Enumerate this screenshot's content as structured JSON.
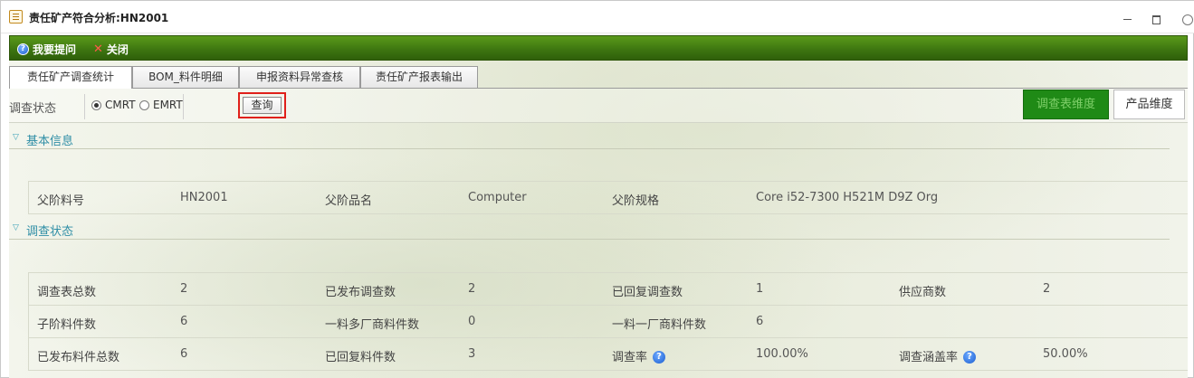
{
  "window": {
    "title": "责任矿产符合分析:HN2001"
  },
  "toolbar": {
    "ask_label": "我要提问",
    "close_label": "关闭"
  },
  "tabs": [
    {
      "label": "责任矿产调查统计"
    },
    {
      "label": "BOM_料件明细"
    },
    {
      "label": "申报资料异常查核"
    },
    {
      "label": "责任矿产报表输出"
    }
  ],
  "query": {
    "status_label": "调查状态",
    "options": [
      {
        "label": "CMRT",
        "checked": true
      },
      {
        "label": "EMRT",
        "checked": false
      }
    ],
    "query_button": "查询",
    "dim_survey": "调查表维度",
    "dim_product": "产品维度"
  },
  "basic_info": {
    "header": "基本信息",
    "fields": [
      {
        "label": "父阶料号",
        "value": "HN2001"
      },
      {
        "label": "父阶品名",
        "value": "Computer"
      },
      {
        "label": "父阶规格",
        "value": "Core i52-7300 H521M D9Z Org"
      }
    ]
  },
  "survey_status": {
    "header": "调查状态",
    "rows": [
      [
        {
          "label": "调查表总数",
          "value": "2"
        },
        {
          "label": "已发布调查数",
          "value": "2"
        },
        {
          "label": "已回复调查数",
          "value": "1"
        },
        {
          "label": "供应商数",
          "value": "2"
        }
      ],
      [
        {
          "label": "子阶料件数",
          "value": "6"
        },
        {
          "label": "一料多厂商料件数",
          "value": "0"
        },
        {
          "label": "一料一厂商料件数",
          "value": "6"
        }
      ],
      [
        {
          "label": "已发布料件总数",
          "value": "6"
        },
        {
          "label": "已回复料件数",
          "value": "3"
        },
        {
          "label": "调查率",
          "value": "100.00%"
        },
        {
          "label": "调查涵盖率",
          "value": "50.00%"
        }
      ]
    ]
  },
  "colors": {
    "toolbar_green": "#3c7410",
    "accent_teal": "#2f8ea6",
    "highlight_red": "#e0201a",
    "dim_active": "#1f8a16"
  }
}
